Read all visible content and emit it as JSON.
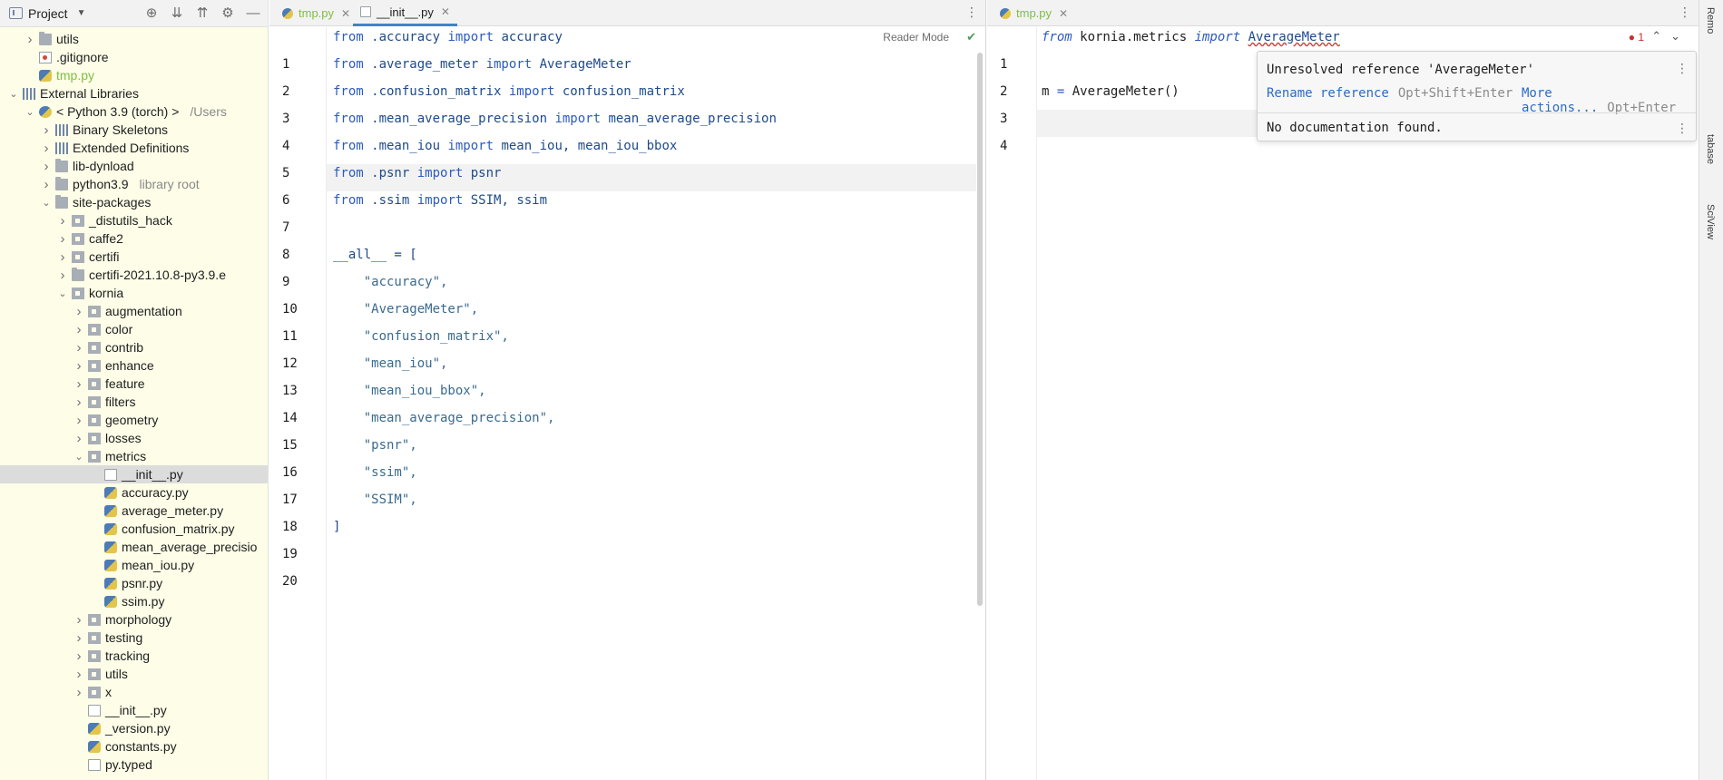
{
  "project_panel": {
    "title": "Project",
    "tree": [
      {
        "label": "utils",
        "level": 1,
        "icon": "folder-icon",
        "chevron": "right"
      },
      {
        "label": ".gitignore",
        "level": 1,
        "icon": "gitignore-icon",
        "chevron": ""
      },
      {
        "label": "tmp.py",
        "level": 1,
        "icon": "python-file-icon",
        "chevron": "",
        "style": "green"
      },
      {
        "label": "External Libraries",
        "level": 0,
        "icon": "library-icon",
        "chevron": "down"
      },
      {
        "label": "< Python 3.9 (torch) >",
        "hint": "/Users",
        "level": 1,
        "icon": "python-sdk-icon",
        "chevron": "down"
      },
      {
        "label": "Binary Skeletons",
        "level": 2,
        "icon": "library-icon",
        "chevron": "right"
      },
      {
        "label": "Extended Definitions",
        "level": 2,
        "icon": "library-icon",
        "chevron": "right"
      },
      {
        "label": "lib-dynload",
        "level": 2,
        "icon": "folder-icon",
        "chevron": "right"
      },
      {
        "label": "python3.9",
        "hint": "library root",
        "level": 2,
        "icon": "folder-icon",
        "chevron": "right"
      },
      {
        "label": "site-packages",
        "level": 2,
        "icon": "folder-icon",
        "chevron": "down"
      },
      {
        "label": "_distutils_hack",
        "level": 3,
        "icon": "package-icon",
        "chevron": "right"
      },
      {
        "label": "caffe2",
        "level": 3,
        "icon": "package-icon",
        "chevron": "right"
      },
      {
        "label": "certifi",
        "level": 3,
        "icon": "package-icon",
        "chevron": "right"
      },
      {
        "label": "certifi-2021.10.8-py3.9.e",
        "level": 3,
        "icon": "folder-icon",
        "chevron": "right"
      },
      {
        "label": "kornia",
        "level": 3,
        "icon": "package-icon",
        "chevron": "down"
      },
      {
        "label": "augmentation",
        "level": 4,
        "icon": "package-icon",
        "chevron": "right"
      },
      {
        "label": "color",
        "level": 4,
        "icon": "package-icon",
        "chevron": "right"
      },
      {
        "label": "contrib",
        "level": 4,
        "icon": "package-icon",
        "chevron": "right"
      },
      {
        "label": "enhance",
        "level": 4,
        "icon": "package-icon",
        "chevron": "right"
      },
      {
        "label": "feature",
        "level": 4,
        "icon": "package-icon",
        "chevron": "right"
      },
      {
        "label": "filters",
        "level": 4,
        "icon": "package-icon",
        "chevron": "right"
      },
      {
        "label": "geometry",
        "level": 4,
        "icon": "package-icon",
        "chevron": "right"
      },
      {
        "label": "losses",
        "level": 4,
        "icon": "package-icon",
        "chevron": "right"
      },
      {
        "label": "metrics",
        "level": 4,
        "icon": "package-icon",
        "chevron": "down"
      },
      {
        "label": "__init__.py",
        "level": 5,
        "icon": "init-file-icon",
        "chevron": "",
        "selected": true
      },
      {
        "label": "accuracy.py",
        "level": 5,
        "icon": "python-file-icon",
        "chevron": ""
      },
      {
        "label": "average_meter.py",
        "level": 5,
        "icon": "python-file-icon",
        "chevron": ""
      },
      {
        "label": "confusion_matrix.py",
        "level": 5,
        "icon": "python-file-icon",
        "chevron": ""
      },
      {
        "label": "mean_average_precisio",
        "level": 5,
        "icon": "python-file-icon",
        "chevron": ""
      },
      {
        "label": "mean_iou.py",
        "level": 5,
        "icon": "python-file-icon",
        "chevron": ""
      },
      {
        "label": "psnr.py",
        "level": 5,
        "icon": "python-file-icon",
        "chevron": ""
      },
      {
        "label": "ssim.py",
        "level": 5,
        "icon": "python-file-icon",
        "chevron": ""
      },
      {
        "label": "morphology",
        "level": 4,
        "icon": "package-icon",
        "chevron": "right"
      },
      {
        "label": "testing",
        "level": 4,
        "icon": "package-icon",
        "chevron": "right"
      },
      {
        "label": "tracking",
        "level": 4,
        "icon": "package-icon",
        "chevron": "right"
      },
      {
        "label": "utils",
        "level": 4,
        "icon": "package-icon",
        "chevron": "right"
      },
      {
        "label": "x",
        "level": 4,
        "icon": "package-icon",
        "chevron": "right"
      },
      {
        "label": "__init__.py",
        "level": 4,
        "icon": "init-file-icon",
        "chevron": ""
      },
      {
        "label": "_version.py",
        "level": 4,
        "icon": "python-file-icon",
        "chevron": ""
      },
      {
        "label": "constants.py",
        "level": 4,
        "icon": "python-file-icon",
        "chevron": ""
      },
      {
        "label": "py.typed",
        "level": 4,
        "icon": "file-icon",
        "chevron": ""
      }
    ]
  },
  "editor_left": {
    "tabs": [
      {
        "label": "tmp.py",
        "style": "green",
        "active": false
      },
      {
        "label": "__init__.py",
        "style": "normal",
        "active": true
      }
    ],
    "reader_mode": "Reader Mode",
    "current_line": 6,
    "lines": [
      [
        [
          "kw",
          "from"
        ],
        [
          "id",
          " .accuracy "
        ],
        [
          "kw",
          "import"
        ],
        [
          "id",
          " accuracy"
        ]
      ],
      [
        [
          "kw",
          "from"
        ],
        [
          "id",
          " .average_meter "
        ],
        [
          "kw",
          "import"
        ],
        [
          "id",
          " AverageMeter"
        ]
      ],
      [
        [
          "kw",
          "from"
        ],
        [
          "id",
          " .confusion_matrix "
        ],
        [
          "kw",
          "import"
        ],
        [
          "id",
          " confusion_matrix"
        ]
      ],
      [
        [
          "kw",
          "from"
        ],
        [
          "id",
          " .mean_average_precision "
        ],
        [
          "kw",
          "import"
        ],
        [
          "id",
          " mean_average_precision"
        ]
      ],
      [
        [
          "kw",
          "from"
        ],
        [
          "id",
          " .mean_iou "
        ],
        [
          "kw",
          "import"
        ],
        [
          "id",
          " mean_iou, mean_iou_bbox"
        ]
      ],
      [
        [
          "kw",
          "from"
        ],
        [
          "id",
          " .psnr "
        ],
        [
          "kw",
          "import"
        ],
        [
          "id",
          " psnr"
        ]
      ],
      [
        [
          "kw",
          "from"
        ],
        [
          "id",
          " .ssim "
        ],
        [
          "kw",
          "import"
        ],
        [
          "id",
          " SSIM, ssim"
        ]
      ],
      [],
      [
        [
          "id",
          "__all__ = ["
        ]
      ],
      [
        [
          "str",
          "    \"accuracy\","
        ]
      ],
      [
        [
          "str",
          "    \"AverageMeter\","
        ]
      ],
      [
        [
          "str",
          "    \"confusion_matrix\","
        ]
      ],
      [
        [
          "str",
          "    \"mean_iou\","
        ]
      ],
      [
        [
          "str",
          "    \"mean_iou_bbox\","
        ]
      ],
      [
        [
          "str",
          "    \"mean_average_precision\","
        ]
      ],
      [
        [
          "str",
          "    \"psnr\","
        ]
      ],
      [
        [
          "str",
          "    \"ssim\","
        ]
      ],
      [
        [
          "str",
          "    \"SSIM\","
        ]
      ],
      [
        [
          "id",
          "]"
        ]
      ],
      []
    ]
  },
  "editor_right": {
    "tabs": [
      {
        "label": "tmp.py",
        "style": "green",
        "active": false
      }
    ],
    "error_count": "1",
    "current_line": 4,
    "lines": [
      [
        [
          "kw-i",
          "from"
        ],
        [
          "plain",
          " kornia.metrics "
        ],
        [
          "kw-i",
          "import"
        ],
        [
          "plain",
          " "
        ],
        [
          "unres",
          "AverageMeter"
        ]
      ],
      [],
      [
        [
          "plain",
          "m "
        ],
        [
          "kw",
          "="
        ],
        [
          "plain",
          " AverageMeter()"
        ]
      ],
      []
    ]
  },
  "popup": {
    "title": "Unresolved reference 'AverageMeter'",
    "action1": "Rename reference",
    "action1_shortcut": "Opt+Shift+Enter",
    "action2": "More actions...",
    "action2_shortcut": "Opt+Enter",
    "doc": "No documentation found."
  },
  "right_strip": {
    "labels": [
      "Remo",
      "tabase",
      "SciView"
    ]
  }
}
